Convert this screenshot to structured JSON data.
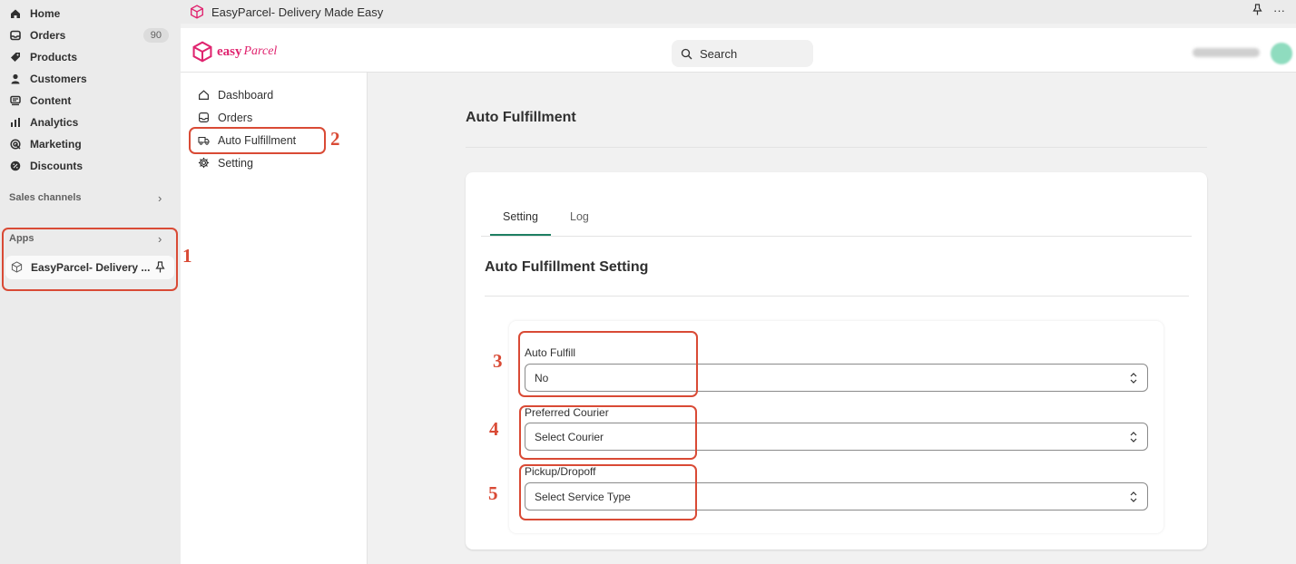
{
  "admin_nav": {
    "items": [
      {
        "label": "Home",
        "icon": "home-icon"
      },
      {
        "label": "Orders",
        "icon": "orders-icon",
        "badge": "90"
      },
      {
        "label": "Products",
        "icon": "tag-icon"
      },
      {
        "label": "Customers",
        "icon": "person-icon"
      },
      {
        "label": "Content",
        "icon": "content-icon"
      },
      {
        "label": "Analytics",
        "icon": "bar-chart-icon"
      },
      {
        "label": "Marketing",
        "icon": "target-icon"
      },
      {
        "label": "Discounts",
        "icon": "discount-icon"
      }
    ],
    "sales_channels_label": "Sales channels",
    "apps_label": "Apps",
    "app_entry_label": "EasyParcel- Delivery ..."
  },
  "topbar": {
    "title": "EasyParcel- Delivery Made Easy",
    "more": "···"
  },
  "app_header": {
    "logo_word": "easy",
    "logo_script": "Parcel",
    "search_placeholder": "Search"
  },
  "app_sidebar": {
    "items": [
      {
        "label": "Dashboard",
        "icon": "home-icon"
      },
      {
        "label": "Orders",
        "icon": "orders-icon"
      },
      {
        "label": "Auto Fulfillment",
        "icon": "truck-icon"
      },
      {
        "label": "Setting",
        "icon": "gear-icon"
      }
    ]
  },
  "main": {
    "page_title": "Auto Fulfillment",
    "tabs": [
      {
        "label": "Setting",
        "active": true
      },
      {
        "label": "Log",
        "active": false
      }
    ],
    "section_title": "Auto Fulfillment Setting",
    "fields": [
      {
        "label": "Auto Fulfill",
        "value": "No"
      },
      {
        "label": "Preferred Courier",
        "value": "Select Courier"
      },
      {
        "label": "Pickup/Dropoff",
        "value": "Select Service Type"
      }
    ]
  },
  "annotations": [
    "1",
    "2",
    "3",
    "4",
    "5"
  ],
  "colors": {
    "annotation": "#d94a35",
    "brand": "#e0246f",
    "tab_active": "#1e7f62"
  }
}
